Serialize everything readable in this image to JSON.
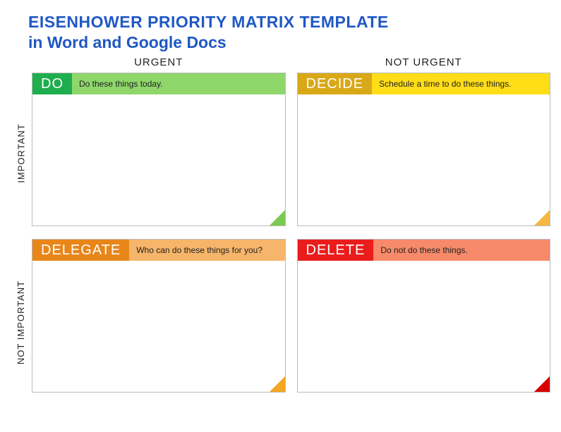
{
  "title": {
    "line1": "EISENHOWER PRIORITY MATRIX TEMPLATE",
    "line2": "in Word and Google Docs"
  },
  "columns": [
    {
      "label": "URGENT"
    },
    {
      "label": "NOT URGENT"
    }
  ],
  "rows": [
    {
      "label": "IMPORTANT"
    },
    {
      "label": "NOT IMPORTANT"
    }
  ],
  "quadrants": {
    "do": {
      "tag": "DO",
      "desc": "Do these things today.",
      "colors": {
        "tag": "#1eae4e",
        "desc_bg": "#8fd66b",
        "corner": "#7bc94f"
      }
    },
    "decide": {
      "tag": "DECIDE",
      "desc": "Schedule a time to do these things.",
      "colors": {
        "tag": "#d9a817",
        "desc_bg": "#ffdd17",
        "corner": "#f5b742"
      }
    },
    "delegate": {
      "tag": "DELEGATE",
      "desc": "Who can do these things for you?",
      "colors": {
        "tag": "#e8861a",
        "desc_bg": "#f6b56a",
        "corner": "#f5a623"
      }
    },
    "delete": {
      "tag": "DELETE",
      "desc": "Do not do these things.",
      "colors": {
        "tag": "#eb1c1c",
        "desc_bg": "#f68a6a",
        "corner": "#d60000"
      }
    }
  }
}
